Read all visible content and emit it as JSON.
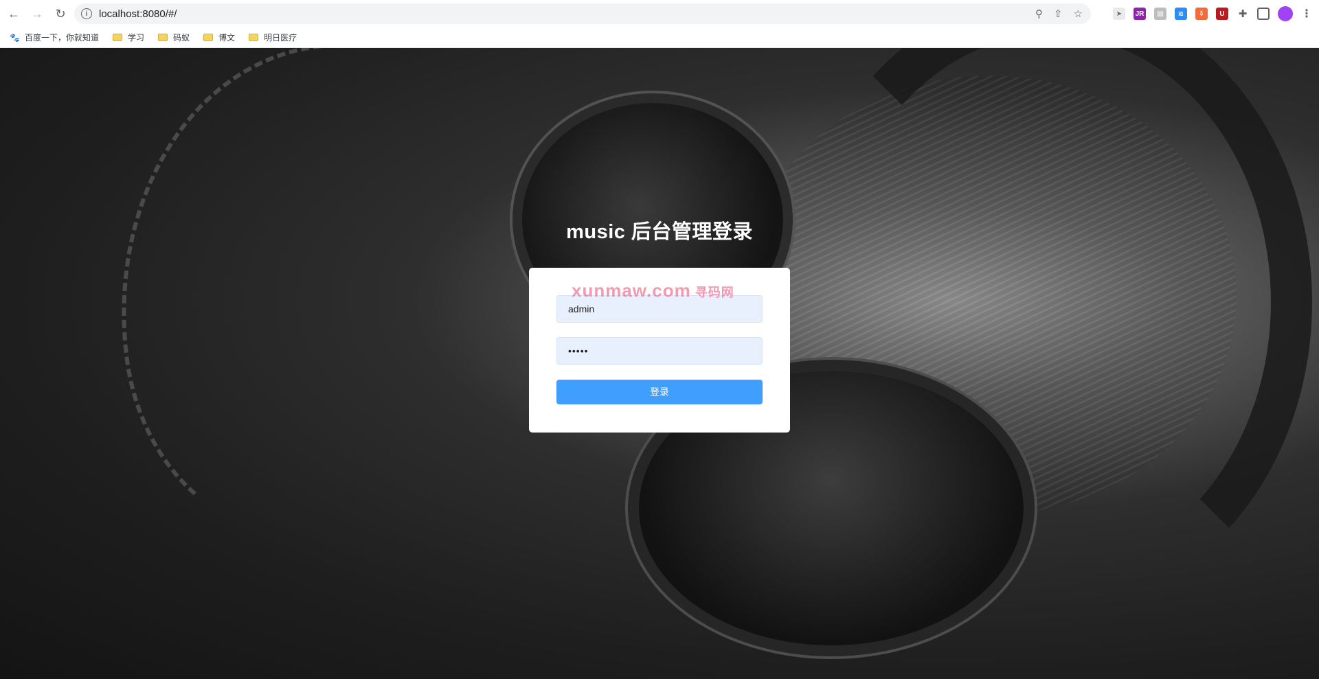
{
  "browser": {
    "url": "localhost:8080/#/",
    "bookmarks": [
      "百度一下，你就知道",
      "学习",
      "码蚁",
      "博文",
      "明日医疗"
    ]
  },
  "page": {
    "title": "music 后台管理登录",
    "username_value": "admin",
    "password_value": "•••••",
    "login_label": "登录",
    "watermark_main": "xunmaw.com",
    "watermark_cn": "寻码网"
  },
  "colors": {
    "primary_button": "#409eff",
    "input_bg": "#e8f0fe"
  }
}
